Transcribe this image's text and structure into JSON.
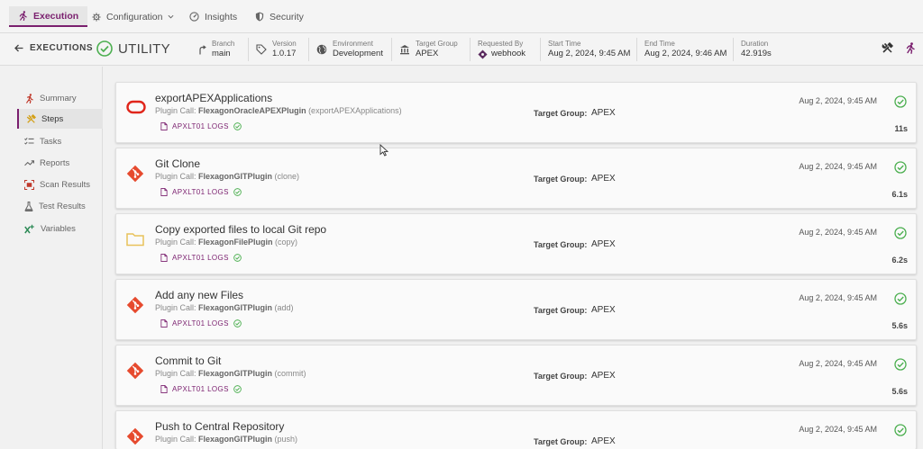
{
  "tabs": [
    {
      "label": "Execution",
      "icon": "runner-icon"
    },
    {
      "label": "Configuration",
      "icon": "gear-icon"
    },
    {
      "label": "Insights",
      "icon": "gauge-icon"
    },
    {
      "label": "Security",
      "icon": "shield-icon"
    }
  ],
  "header": {
    "back_label": "EXECUTIONS",
    "title": "UTILITY",
    "branch": {
      "label": "Branch",
      "value": "main"
    },
    "version": {
      "label": "Version",
      "value": "1.0.17"
    },
    "environment": {
      "label": "Environment",
      "value": "Development"
    },
    "target_group": {
      "label": "Target Group",
      "value": "APEX"
    },
    "requested_by": {
      "label": "Requested By",
      "value": "webhook"
    },
    "start_time": {
      "label": "Start Time",
      "value": "Aug 2, 2024, 9:45 AM"
    },
    "end_time": {
      "label": "End Time",
      "value": "Aug 2, 2024, 9:46 AM"
    },
    "duration": {
      "label": "Duration",
      "value": "42.919s"
    }
  },
  "sidebar": {
    "items": [
      {
        "label": "Summary"
      },
      {
        "label": "Steps"
      },
      {
        "label": "Tasks"
      },
      {
        "label": "Reports"
      },
      {
        "label": "Scan Results"
      },
      {
        "label": "Test Results"
      },
      {
        "label": "Variables"
      }
    ]
  },
  "steps": [
    {
      "title": "exportAPEXApplications",
      "plugin_prefix": "Plugin Call: ",
      "plugin_name": "FlexagonOracleAPEXPlugin",
      "plugin_op": " (exportAPEXApplications)",
      "logs": "APXLT01 LOGS",
      "tg_label": "Target Group:",
      "tg_value": "APEX",
      "date": "Aug 2, 2024, 9:45 AM",
      "duration": "11s",
      "icon": "oracle-icon"
    },
    {
      "title": "Git Clone",
      "plugin_prefix": "Plugin Call: ",
      "plugin_name": "FlexagonGITPlugin",
      "plugin_op": " (clone)",
      "logs": "APXLT01 LOGS",
      "tg_label": "Target Group:",
      "tg_value": "APEX",
      "date": "Aug 2, 2024, 9:45 AM",
      "duration": "6.1s",
      "icon": "git-icon"
    },
    {
      "title": "Copy exported files to local Git repo",
      "plugin_prefix": "Plugin Call: ",
      "plugin_name": "FlexagonFilePlugin",
      "plugin_op": " (copy)",
      "logs": "APXLT01 LOGS",
      "tg_label": "Target Group:",
      "tg_value": "APEX",
      "date": "Aug 2, 2024, 9:45 AM",
      "duration": "6.2s",
      "icon": "folder-icon"
    },
    {
      "title": "Add any new Files",
      "plugin_prefix": "Plugin Call: ",
      "plugin_name": "FlexagonGITPlugin",
      "plugin_op": " (add)",
      "logs": "APXLT01 LOGS",
      "tg_label": "Target Group:",
      "tg_value": "APEX",
      "date": "Aug 2, 2024, 9:45 AM",
      "duration": "5.6s",
      "icon": "git-icon"
    },
    {
      "title": "Commit to Git",
      "plugin_prefix": "Plugin Call: ",
      "plugin_name": "FlexagonGITPlugin",
      "plugin_op": " (commit)",
      "logs": "APXLT01 LOGS",
      "tg_label": "Target Group:",
      "tg_value": "APEX",
      "date": "Aug 2, 2024, 9:45 AM",
      "duration": "5.6s",
      "icon": "git-icon"
    },
    {
      "title": "Push to Central Repository",
      "plugin_prefix": "Plugin Call: ",
      "plugin_name": "FlexagonGITPlugin",
      "plugin_op": " (push)",
      "logs": "",
      "tg_label": "Target Group:",
      "tg_value": "APEX",
      "date": "Aug 2, 2024, 9:45 AM",
      "duration": "",
      "icon": "git-icon"
    }
  ],
  "colors": {
    "accent": "#7a1f6e",
    "success": "#4caf50",
    "git": "#e64a2e",
    "oracle": "#e0261b",
    "folder": "#e8c15a"
  }
}
